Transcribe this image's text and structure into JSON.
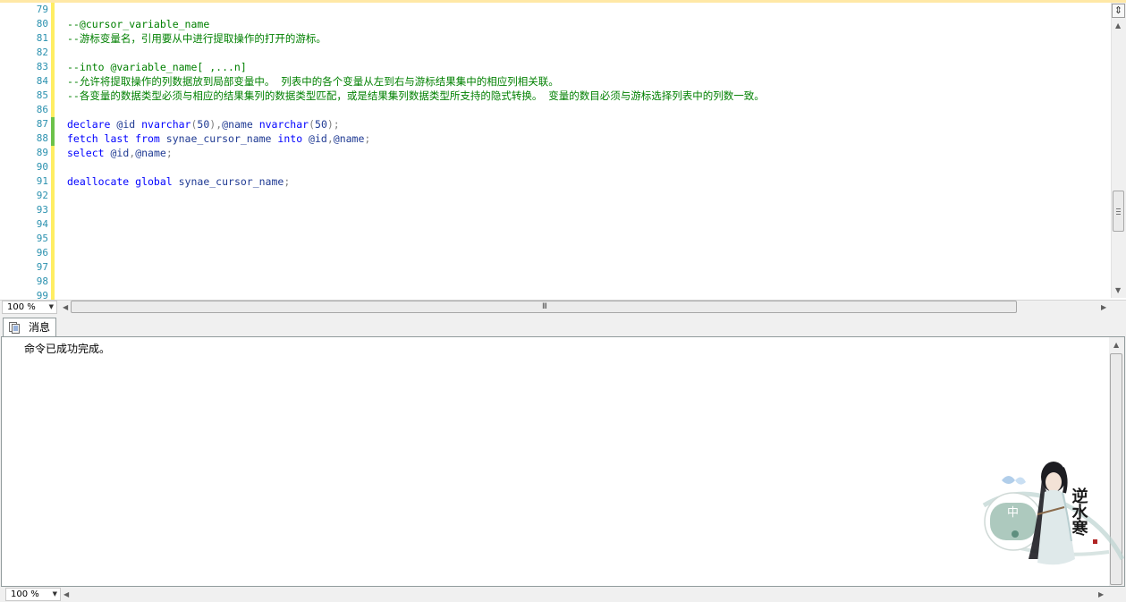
{
  "editor": {
    "line_numbers": [
      "79",
      "80",
      "81",
      "82",
      "83",
      "84",
      "85",
      "86",
      "87",
      "88",
      "89",
      "90",
      "91",
      "92",
      "93",
      "94",
      "95",
      "96",
      "97",
      "98",
      "99"
    ],
    "lines": [
      {
        "num": "79",
        "segments": []
      },
      {
        "num": "80",
        "segments": [
          {
            "t": "--@cursor_variable_name",
            "c": "cm"
          }
        ]
      },
      {
        "num": "81",
        "segments": [
          {
            "t": "--游标变量名，引用要从中进行提取操作的打开的游标。",
            "c": "cm"
          }
        ]
      },
      {
        "num": "82",
        "segments": []
      },
      {
        "num": "83",
        "segments": [
          {
            "t": "--into @variable_name[ ,...n]",
            "c": "cm"
          }
        ]
      },
      {
        "num": "84",
        "segments": [
          {
            "t": "--允许将提取操作的列数据放到局部变量中。 列表中的各个变量从左到右与游标结果集中的相应列相关联。",
            "c": "cm"
          }
        ]
      },
      {
        "num": "85",
        "segments": [
          {
            "t": "--各变量的数据类型必须与相应的结果集列的数据类型匹配，或是结果集列数据类型所支持的隐式转换。 变量的数目必须与游标选择列表中的列数一致。",
            "c": "cm"
          }
        ]
      },
      {
        "num": "86",
        "segments": []
      },
      {
        "num": "87",
        "segments": [
          {
            "t": "declare",
            "c": "kw"
          },
          {
            "t": " @id ",
            "c": "vr"
          },
          {
            "t": "nvarchar",
            "c": "kw"
          },
          {
            "t": "(",
            "c": "gy"
          },
          {
            "t": "50",
            "c": "tp"
          },
          {
            "t": "),",
            "c": "gy"
          },
          {
            "t": "@name ",
            "c": "vr"
          },
          {
            "t": "nvarchar",
            "c": "kw"
          },
          {
            "t": "(",
            "c": "gy"
          },
          {
            "t": "50",
            "c": "tp"
          },
          {
            "t": ");",
            "c": "gy"
          }
        ]
      },
      {
        "num": "88",
        "segments": [
          {
            "t": "fetch last from",
            "c": "kw"
          },
          {
            "t": " synae_cursor_name ",
            "c": "vr"
          },
          {
            "t": "into",
            "c": "kw"
          },
          {
            "t": " @id",
            "c": "vr"
          },
          {
            "t": ",",
            "c": "gy"
          },
          {
            "t": "@name",
            "c": "vr"
          },
          {
            "t": ";",
            "c": "gy"
          }
        ]
      },
      {
        "num": "89",
        "segments": [
          {
            "t": "select",
            "c": "kw"
          },
          {
            "t": " @id",
            "c": "vr"
          },
          {
            "t": ",",
            "c": "gy"
          },
          {
            "t": "@name",
            "c": "vr"
          },
          {
            "t": ";",
            "c": "gy"
          }
        ]
      },
      {
        "num": "90",
        "segments": []
      },
      {
        "num": "91",
        "segments": [
          {
            "t": "deallocate global",
            "c": "kw"
          },
          {
            "t": " synae_cursor_name",
            "c": "vr"
          },
          {
            "t": ";",
            "c": "gy"
          }
        ]
      },
      {
        "num": "92",
        "segments": []
      },
      {
        "num": "93",
        "segments": []
      },
      {
        "num": "94",
        "segments": []
      },
      {
        "num": "95",
        "segments": []
      },
      {
        "num": "96",
        "segments": []
      },
      {
        "num": "97",
        "segments": []
      },
      {
        "num": "98",
        "segments": []
      },
      {
        "num": "99",
        "segments": []
      }
    ],
    "zoom": "100 %",
    "hscroll_grip": "III"
  },
  "results": {
    "tab_label": "消息",
    "message": "命令已成功完成。",
    "zoom": "100 %"
  },
  "artwork": {
    "badge_text": "中",
    "logo_text": "逆水寒"
  },
  "colors": {
    "comment": "#008000",
    "keyword": "#0000ff",
    "variable": "#1f3a93",
    "line_number": "#2b91af",
    "change_margin": "#ffee62",
    "saved_change": "#6cc24a"
  }
}
